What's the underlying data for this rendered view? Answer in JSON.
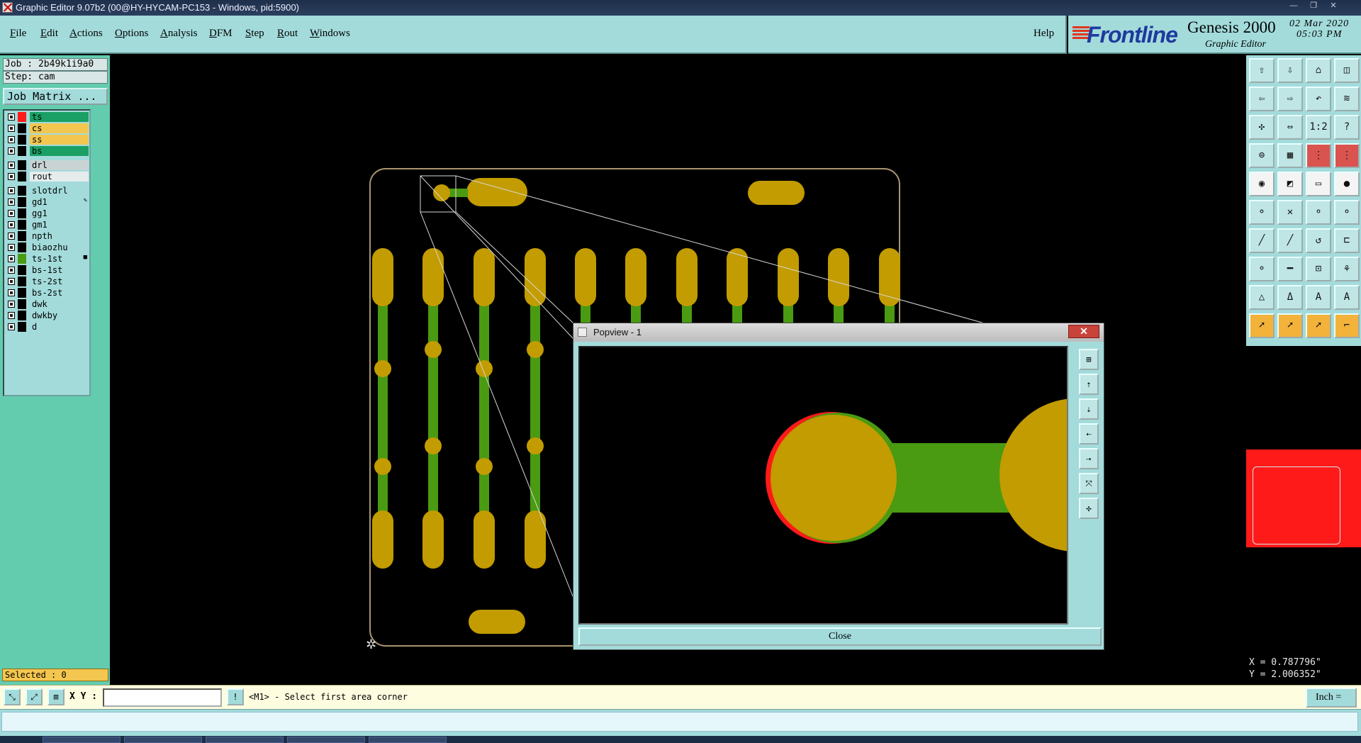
{
  "window": {
    "title": "Graphic Editor 9.07b2 (00@HY-HYCAM-PC153 - Windows, pid:5900)",
    "controls": [
      "—",
      "❐",
      "✕"
    ]
  },
  "menu": {
    "items": [
      {
        "label": "File",
        "mnemonic": "F",
        "rest": "ile"
      },
      {
        "label": "Edit",
        "mnemonic": "E",
        "rest": "dit"
      },
      {
        "label": "Actions",
        "mnemonic": "A",
        "rest": "ctions"
      },
      {
        "label": "Options",
        "mnemonic": "O",
        "rest": "ptions"
      },
      {
        "label": "Analysis",
        "mnemonic": "A",
        "rest": "nalysis"
      },
      {
        "label": "DFM",
        "mnemonic": "D",
        "rest": "FM"
      },
      {
        "label": "Step",
        "mnemonic": "S",
        "rest": "tep"
      },
      {
        "label": "Rout",
        "mnemonic": "R",
        "rest": "out"
      },
      {
        "label": "Windows",
        "mnemonic": "W",
        "rest": "indows"
      }
    ],
    "help": "Help"
  },
  "brand": {
    "logo": "Frontline",
    "product": "Genesis 2000",
    "product_sub": "Graphic Editor",
    "date": "02 Mar 2020",
    "time": "05:03 PM"
  },
  "left": {
    "job": "Job : 2b49k1i9a0",
    "step": "Step: cam",
    "job_matrix": "Job Matrix ...",
    "layers": [
      {
        "name": "ts",
        "color": "#1aa064",
        "swatch": "#ff1a1a",
        "mark": ""
      },
      {
        "name": "cs",
        "color": "#f3c64f",
        "swatch": "#000000",
        "mark": ""
      },
      {
        "name": "ss",
        "color": "#f3c64f",
        "swatch": "#000000",
        "mark": ""
      },
      {
        "name": "bs",
        "color": "#1aa064",
        "swatch": "#000000",
        "mark": ""
      },
      {
        "name": "drl",
        "color": "#c9d3d3",
        "swatch": "#000000",
        "mark": ""
      },
      {
        "name": "rout",
        "color": "#e6ecec",
        "swatch": "#000000",
        "mark": ""
      },
      {
        "name": "slotdrl",
        "color": "#a3dbdb",
        "swatch": "#000000",
        "mark": ""
      },
      {
        "name": "gd1",
        "color": "#a3dbdb",
        "swatch": "#000000",
        "mark": "✎"
      },
      {
        "name": "gg1",
        "color": "#a3dbdb",
        "swatch": "#000000",
        "mark": ""
      },
      {
        "name": "gm1",
        "color": "#a3dbdb",
        "swatch": "#000000",
        "mark": ""
      },
      {
        "name": "npth",
        "color": "#a3dbdb",
        "swatch": "#000000",
        "mark": ""
      },
      {
        "name": "biaozhu",
        "color": "#a3dbdb",
        "swatch": "#000000",
        "mark": ""
      },
      {
        "name": "ts-1st",
        "color": "#a3dbdb",
        "swatch": "#4a9a12",
        "mark": "■"
      },
      {
        "name": "bs-1st",
        "color": "#a3dbdb",
        "swatch": "#000000",
        "mark": ""
      },
      {
        "name": "ts-2st",
        "color": "#a3dbdb",
        "swatch": "#000000",
        "mark": ""
      },
      {
        "name": "bs-2st",
        "color": "#a3dbdb",
        "swatch": "#000000",
        "mark": ""
      },
      {
        "name": "dwk",
        "color": "#a3dbdb",
        "swatch": "#000000",
        "mark": ""
      },
      {
        "name": "dwkby",
        "color": "#a3dbdb",
        "swatch": "#000000",
        "mark": ""
      },
      {
        "name": "d",
        "color": "#a3dbdb",
        "swatch": "#000000",
        "mark": ""
      }
    ],
    "selected": "Selected : 0"
  },
  "popview": {
    "title": "Popview - 1",
    "close_x": "✕",
    "close_button": "Close"
  },
  "coords": {
    "x": "X = 0.787796\"",
    "y": "Y = 2.006352\""
  },
  "bottom": {
    "xy_label": "X Y :",
    "xy_value": "",
    "prompt": "<M1> - Select first area corner",
    "unit": "Inch ="
  },
  "colors": {
    "pad": "#c29c00",
    "trace": "#4a9a12",
    "highlight": "#ff1a1a",
    "panel": "#a3dbdb"
  }
}
